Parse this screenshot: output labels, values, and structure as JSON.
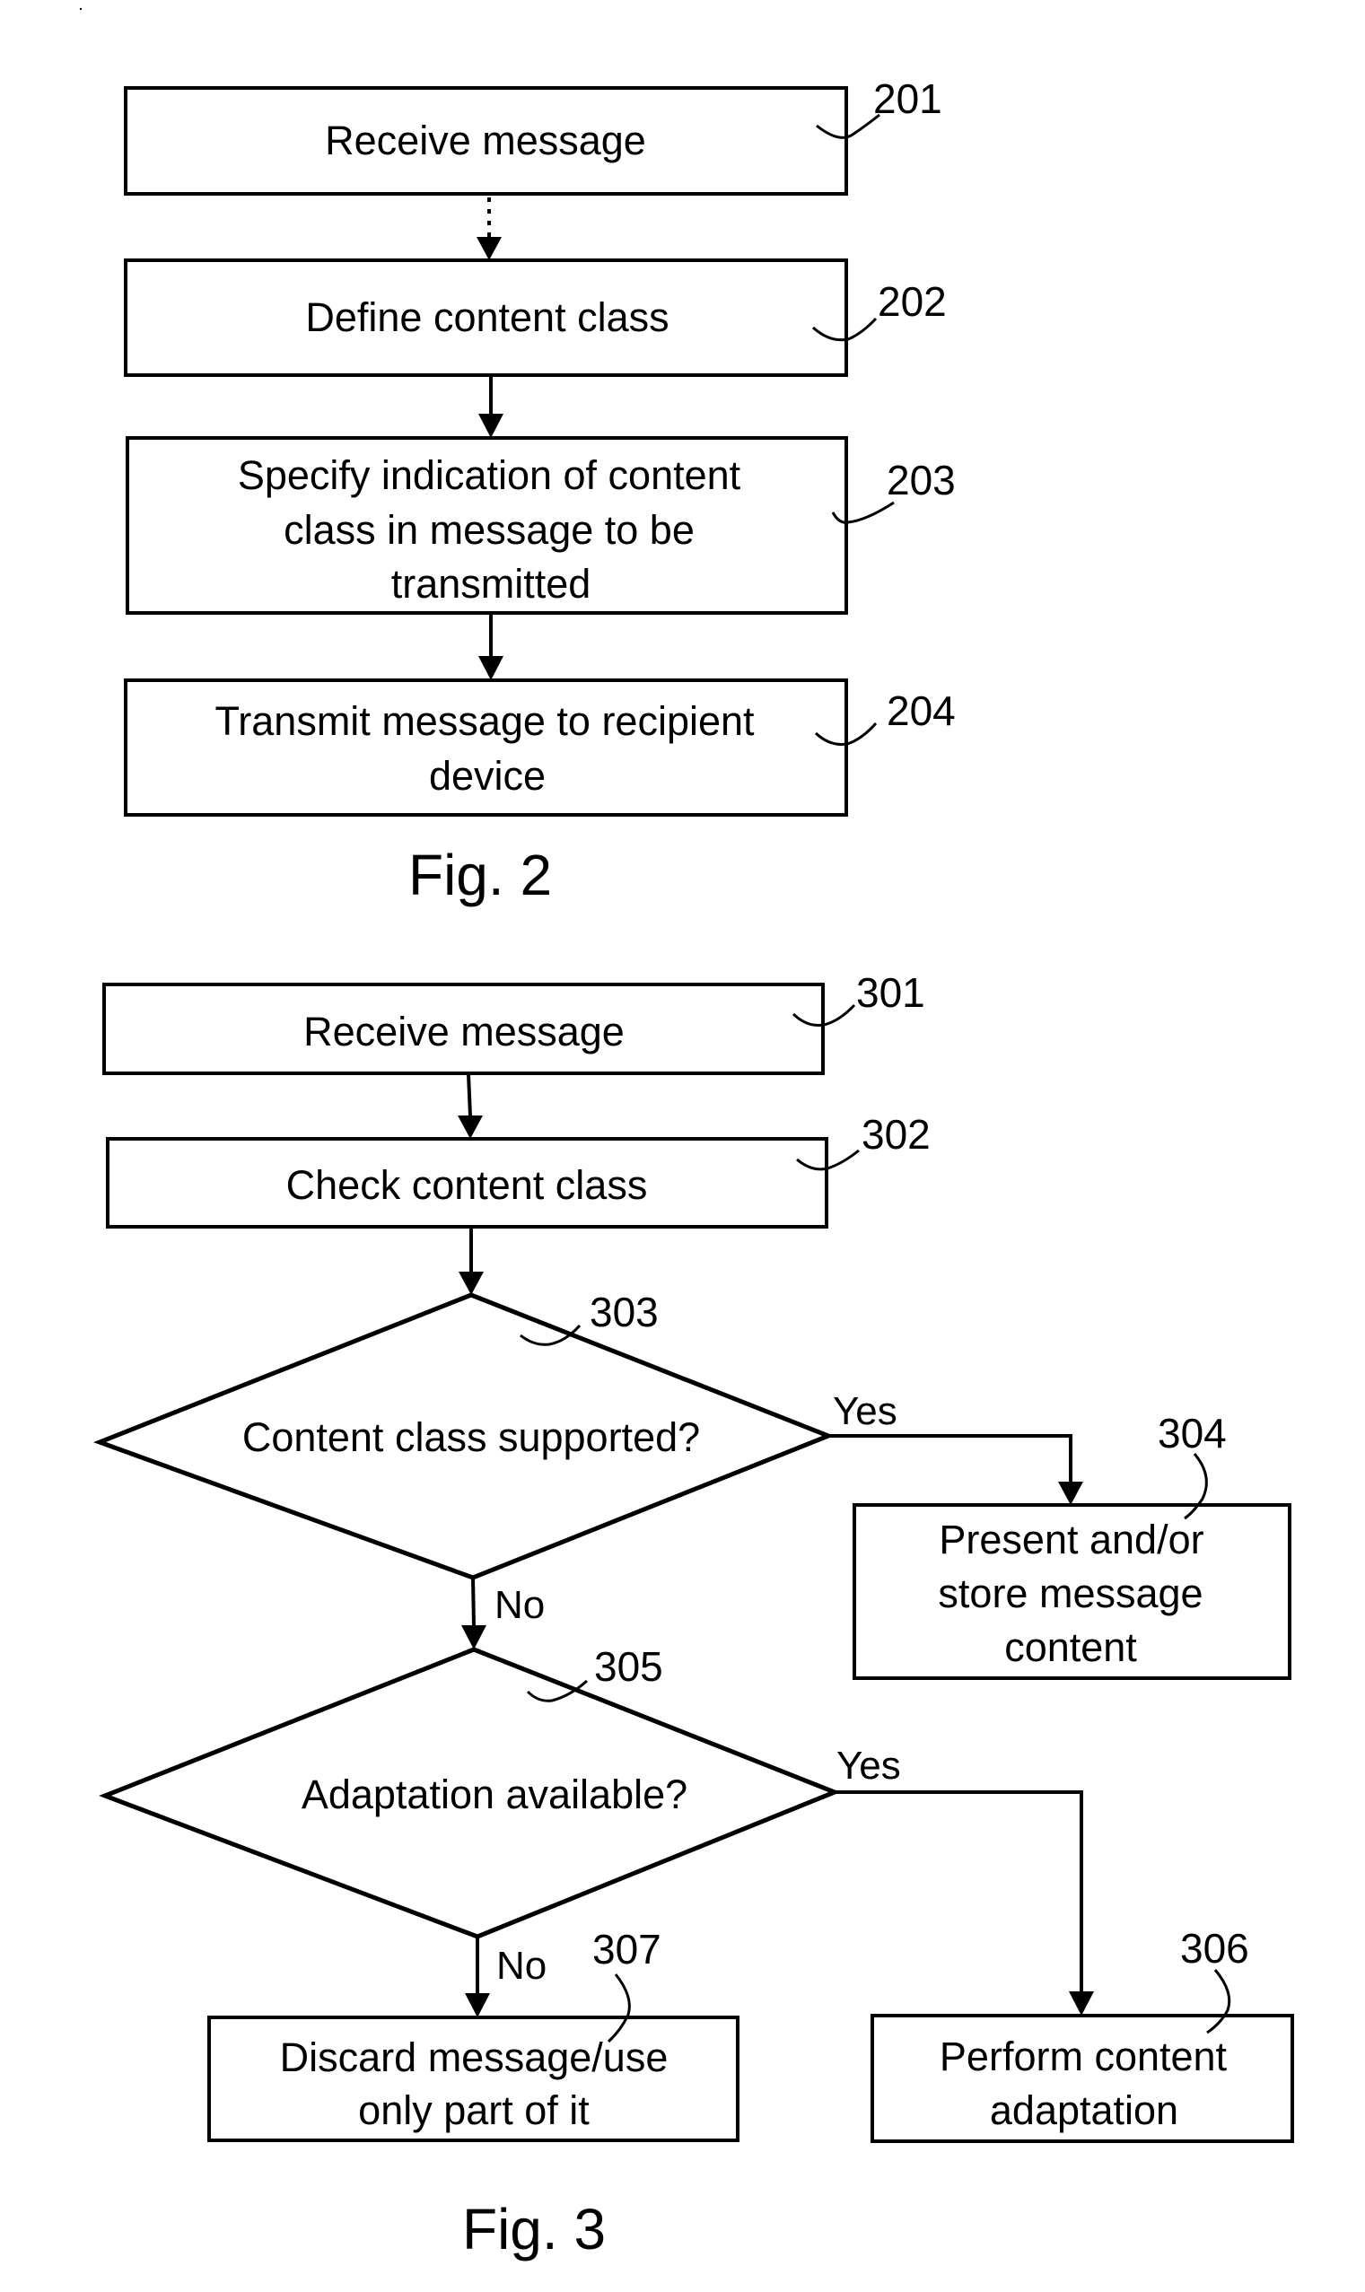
{
  "figures": [
    {
      "caption": "Fig. 2",
      "nodes": [
        {
          "ref": "201",
          "type": "process",
          "lines": [
            "Receive message"
          ]
        },
        {
          "ref": "202",
          "type": "process",
          "lines": [
            "Define content class"
          ]
        },
        {
          "ref": "203",
          "type": "process",
          "lines": [
            "Specify indication of content",
            "class in message to be",
            "transmitted"
          ]
        },
        {
          "ref": "204",
          "type": "process",
          "lines": [
            "Transmit message to recipient",
            "device"
          ]
        }
      ],
      "edges": [
        {
          "from": "201",
          "to": "202",
          "style": "dashed"
        },
        {
          "from": "202",
          "to": "203",
          "style": "solid"
        },
        {
          "from": "203",
          "to": "204",
          "style": "solid"
        }
      ]
    },
    {
      "caption": "Fig. 3",
      "nodes": [
        {
          "ref": "301",
          "type": "process",
          "lines": [
            "Receive message"
          ]
        },
        {
          "ref": "302",
          "type": "process",
          "lines": [
            "Check content class"
          ]
        },
        {
          "ref": "303",
          "type": "decision",
          "lines": [
            "Content class supported?"
          ]
        },
        {
          "ref": "304",
          "type": "process",
          "lines": [
            "Present and/or",
            "store message",
            "content"
          ]
        },
        {
          "ref": "305",
          "type": "decision",
          "lines": [
            "Adaptation available?"
          ]
        },
        {
          "ref": "306",
          "type": "process",
          "lines": [
            "Perform content",
            "adaptation"
          ]
        },
        {
          "ref": "307",
          "type": "process",
          "lines": [
            "Discard message/use",
            "only part of it"
          ]
        }
      ],
      "edges": [
        {
          "from": "301",
          "to": "302",
          "style": "solid",
          "label": ""
        },
        {
          "from": "302",
          "to": "303",
          "style": "solid",
          "label": ""
        },
        {
          "from": "303",
          "to": "304",
          "style": "solid",
          "label": "Yes"
        },
        {
          "from": "303",
          "to": "305",
          "style": "solid",
          "label": "No"
        },
        {
          "from": "305",
          "to": "306",
          "style": "solid",
          "label": "Yes"
        },
        {
          "from": "305",
          "to": "307",
          "style": "solid",
          "label": "No"
        }
      ]
    }
  ]
}
